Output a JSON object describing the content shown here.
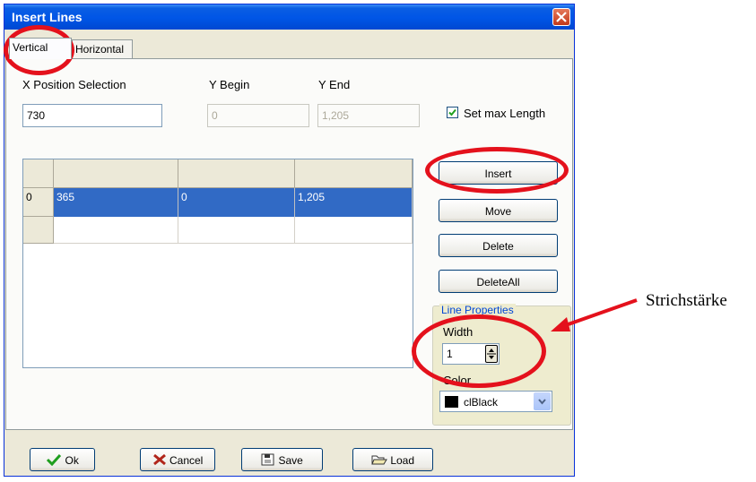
{
  "window": {
    "title": "Insert Lines"
  },
  "tabs": [
    {
      "label": "Vertical"
    },
    {
      "label": "Horizontal"
    }
  ],
  "fields": {
    "x_label": "X Position Selection",
    "x_value": "730",
    "y_begin_label": "Y Begin",
    "y_begin_value": "0",
    "y_end_label": "Y End",
    "y_end_value": "1,205",
    "set_max_label": "Set max Length",
    "set_max_checked": true
  },
  "grid": {
    "headers": [
      "",
      "",
      ""
    ],
    "rows": [
      {
        "index": "0",
        "cells": [
          "365",
          "0",
          "1,205"
        ]
      },
      {
        "index": "",
        "cells": [
          "",
          "",
          ""
        ]
      }
    ]
  },
  "side_buttons": {
    "insert": "Insert",
    "move": "Move",
    "delete": "Delete",
    "delete_all": "DeleteAll"
  },
  "line_properties": {
    "title": "Line Properties",
    "width_label": "Width",
    "width_value": "1",
    "color_label": "Color",
    "color_value": "clBlack",
    "color_swatch": "#000000"
  },
  "bottom_buttons": {
    "ok": "Ok",
    "cancel": "Cancel",
    "save": "Save",
    "load": "Load"
  },
  "annotation": {
    "text": "Strichstärke",
    "color": "#e4111c"
  }
}
